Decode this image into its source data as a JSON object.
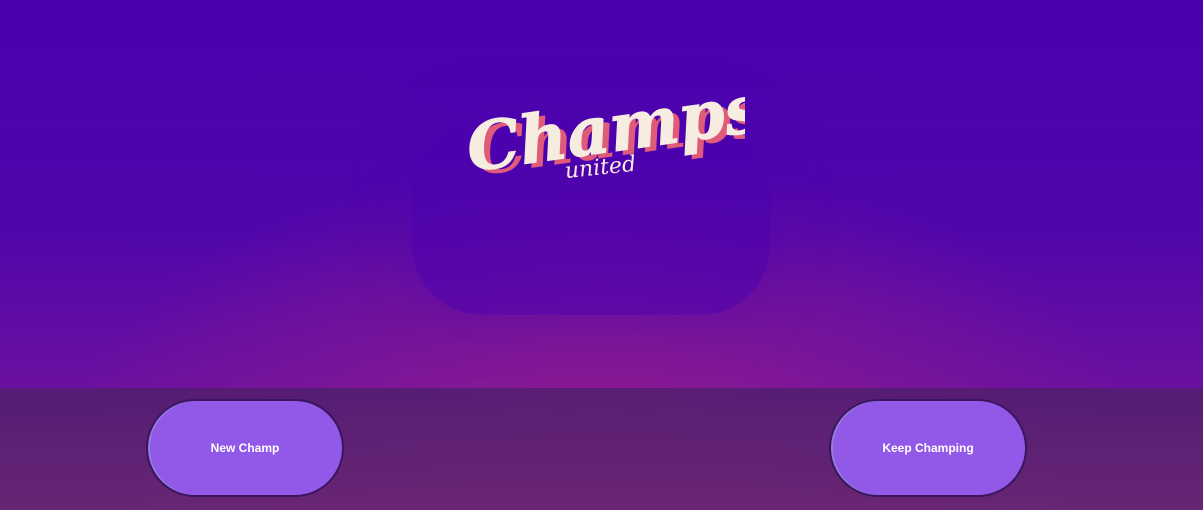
{
  "brand": {
    "logo_main": "Champs",
    "logo_sub": "united"
  },
  "actions": {
    "new_champ_label": "New Champ",
    "keep_champing_label": "Keep Champing"
  },
  "colors": {
    "background_top": "#4b00b0",
    "button_fill": "#9259e8",
    "logo_cream": "#f7ece0",
    "logo_shadow": "#e05a7a"
  }
}
